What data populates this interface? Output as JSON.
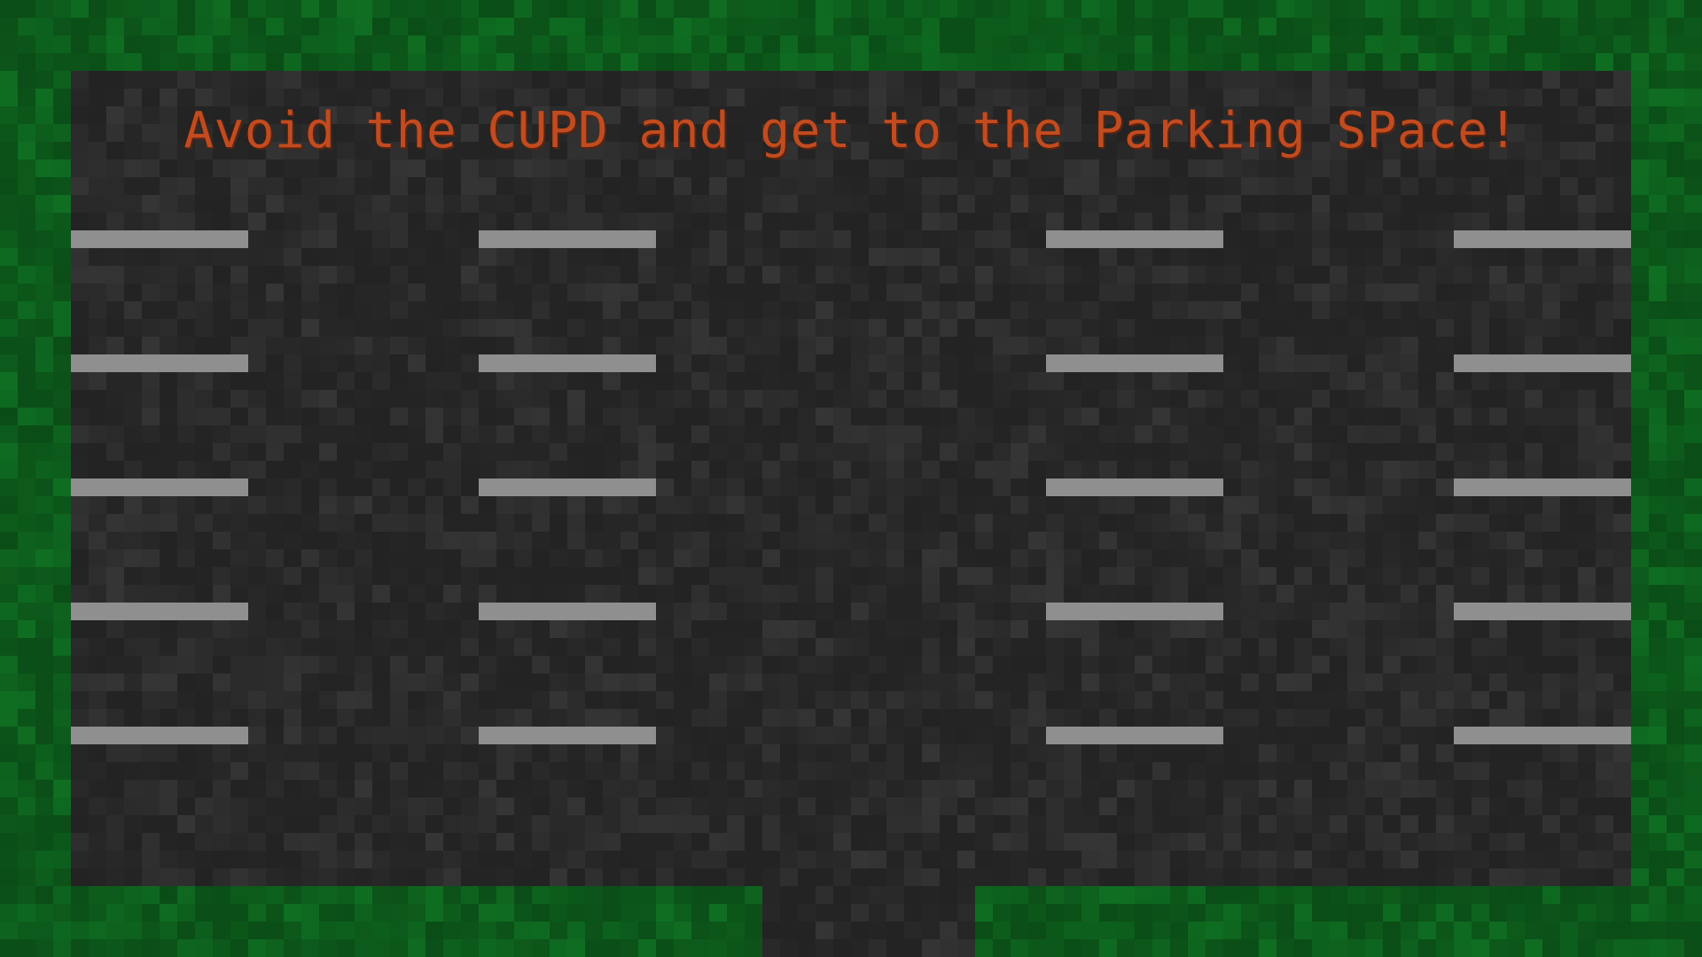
{
  "game": {
    "instructions": "Avoid the CUPD and get to the Parking SPace!"
  },
  "colors": {
    "grass_dark": "#0b4d17",
    "grass_light": "#0f6e22",
    "asphalt_dark": "#232323",
    "asphalt_light": "#3a3a3a",
    "stripe": "#8f8f8f",
    "title_text": "#c24b1f"
  },
  "parking_lot": {
    "stripe_columns": 4,
    "stripe_rows": 5
  }
}
